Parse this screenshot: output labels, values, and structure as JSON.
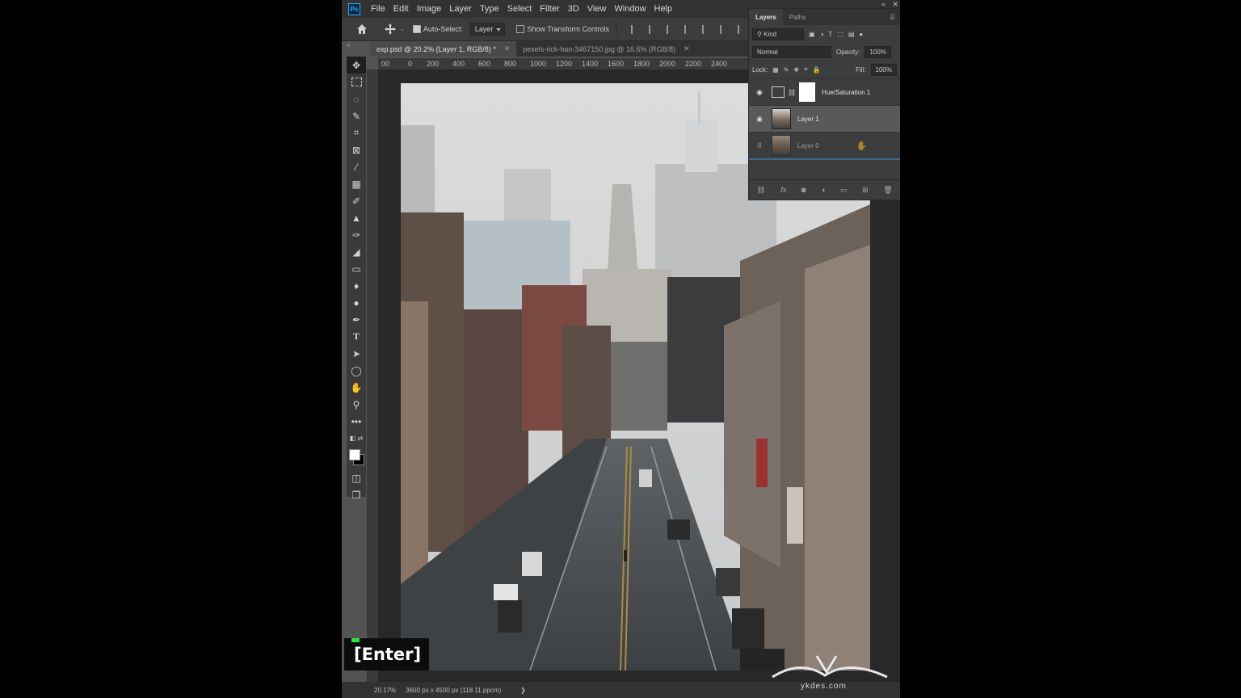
{
  "menubar": {
    "logo": "Ps",
    "items": [
      "File",
      "Edit",
      "Image",
      "Layer",
      "Type",
      "Select",
      "Filter",
      "3D",
      "View",
      "Window",
      "Help"
    ]
  },
  "options": {
    "auto_select_label": "Auto-Select:",
    "auto_select_checked": true,
    "auto_select_target": "Layer",
    "show_transform_label": "Show Transform Controls",
    "show_transform_checked": false
  },
  "tabs": [
    {
      "label": "exp.psd @ 20.2% (Layer 1, RGB/8) *",
      "active": true
    },
    {
      "label": "pexels-rick-han-3467150.jpg @ 16.6% (RGB/8)",
      "active": false
    }
  ],
  "ruler": {
    "top_labels": [
      "00",
      "0",
      "200",
      "400",
      "600",
      "800",
      "1000",
      "1200",
      "1400",
      "1600",
      "1800",
      "2000",
      "2200",
      "2400"
    ]
  },
  "status": {
    "zoom": "20.17%",
    "doc_info": "3600 px x 4500 px (118.11 ppcm)",
    "arrow": "❯"
  },
  "layers_panel": {
    "tabs": [
      "Layers",
      "Paths"
    ],
    "filter_kind": "Kind",
    "blend_mode": "Normal",
    "opacity_label": "Opacity:",
    "opacity_value": "100%",
    "lock_label": "Lock:",
    "fill_label": "Fill:",
    "fill_value": "100%",
    "layers": [
      {
        "name": "Hue/Saturation 1",
        "visible": true,
        "type": "adjustment",
        "selected": false
      },
      {
        "name": "Layer 1",
        "visible": true,
        "type": "pixel",
        "selected": true
      },
      {
        "name": "Layer 0",
        "visible": false,
        "type": "pixel",
        "selected": false,
        "dragging": true
      }
    ]
  },
  "overlay": {
    "key_label": "[Enter]",
    "watermark": "ykdes.com"
  },
  "colors": {
    "accent": "#31a8ff",
    "key_indicator": "#2ee63a"
  }
}
